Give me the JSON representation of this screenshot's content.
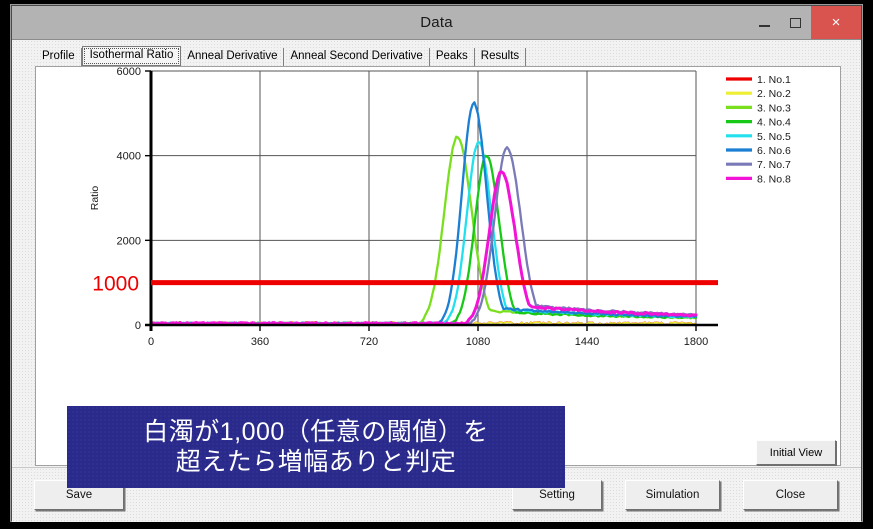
{
  "window": {
    "title": "Data",
    "controls": {
      "minimize": "–",
      "maximize": "☐",
      "close": "×"
    }
  },
  "tabs": [
    {
      "label": "Profile",
      "active": false
    },
    {
      "label": "Isothermal Ratio",
      "active": true
    },
    {
      "label": "Anneal Derivative",
      "active": false
    },
    {
      "label": "Anneal Second Derivative",
      "active": false
    },
    {
      "label": "Peaks",
      "active": false
    },
    {
      "label": "Results",
      "active": false
    }
  ],
  "plot": {
    "initial_view_label": "Initial View",
    "threshold_label": "1000"
  },
  "buttons": {
    "save": "Save",
    "setting": "Setting",
    "simulation": "Simulation",
    "close": "Close"
  },
  "callout": {
    "line1": "白濁が1,000（任意の閾値）を",
    "line2": "超えたら増幅ありと判定",
    "background": "#2a2a8c",
    "text_color": "#ffffff"
  },
  "chart_data": {
    "type": "line",
    "title": "",
    "xlabel": "",
    "ylabel": "Ratio",
    "xlim": [
      0,
      1800
    ],
    "ylim": [
      0,
      6000
    ],
    "xticks": [
      0,
      360,
      720,
      1080,
      1440,
      1800
    ],
    "yticks": [
      0,
      2000,
      4000,
      6000
    ],
    "grid": true,
    "legend_position": "right-outside",
    "threshold": {
      "value": 1000,
      "color": "#ee0000",
      "label": "1000"
    },
    "series": [
      {
        "name": "1. No.1",
        "legend": "1. No.1",
        "color": "#ee0000",
        "peak_x": null,
        "peak_y": 40,
        "baseline": 40,
        "flat": true
      },
      {
        "name": "2. No.2",
        "legend": "2. No.2",
        "color": "#eeee33",
        "peak_x": null,
        "peak_y": 40,
        "baseline": 35,
        "flat": true
      },
      {
        "name": "3. No.3",
        "legend": "3. No.3",
        "color": "#7ae01e",
        "peak_x": 1012,
        "peak_y": 4450,
        "onset_x": 930,
        "width": 58,
        "tail_y": 260,
        "flat": false
      },
      {
        "name": "4. No.4",
        "legend": "4. No.4",
        "color": "#16c916",
        "peak_x": 1108,
        "peak_y": 4000,
        "onset_x": 1030,
        "width": 52,
        "tail_y": 210,
        "flat": false
      },
      {
        "name": "5. No.5",
        "legend": "5. No.5",
        "color": "#22e0ee",
        "peak_x": 1082,
        "peak_y": 4320,
        "onset_x": 1002,
        "width": 52,
        "tail_y": 300,
        "flat": false
      },
      {
        "name": "6. No.6",
        "legend": "6. No.6",
        "color": "#1b7fd4",
        "peak_x": 1066,
        "peak_y": 5250,
        "onset_x": 990,
        "width": 52,
        "tail_y": 320,
        "flat": false
      },
      {
        "name": "7. No.7",
        "legend": "7. No.7",
        "color": "#7a7ab8",
        "peak_x": 1176,
        "peak_y": 4180,
        "onset_x": 1098,
        "width": 56,
        "tail_y": 400,
        "flat": false
      },
      {
        "name": "8. No.8",
        "legend": "8. No.8",
        "color": "#f213d6",
        "peak_x": 1158,
        "peak_y": 3620,
        "onset_x": 1084,
        "width": 55,
        "tail_y": 370,
        "flat": false
      }
    ]
  }
}
